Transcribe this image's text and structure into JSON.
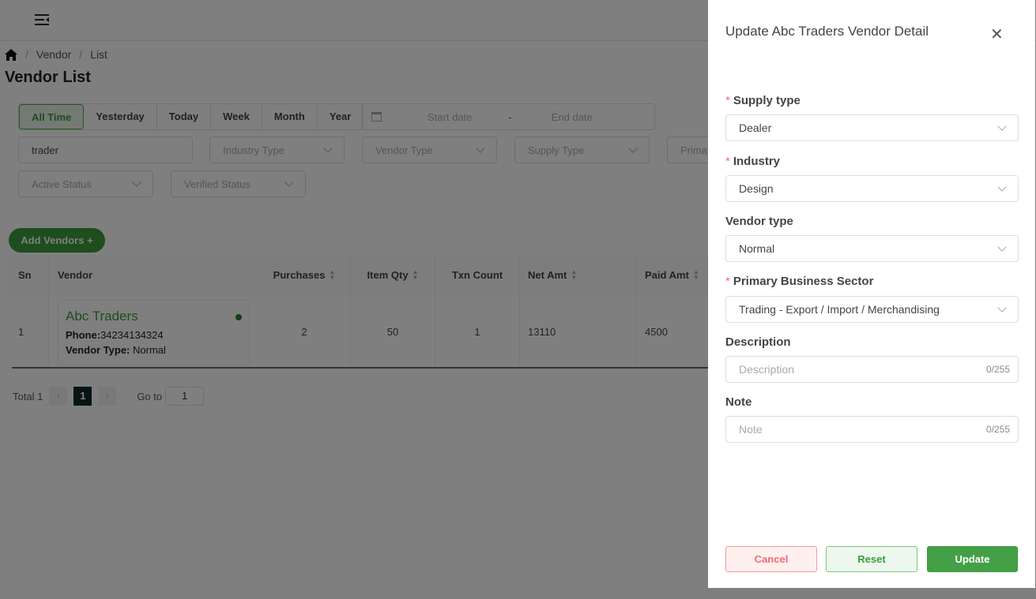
{
  "header": {
    "menu_icon": "menu-fold-icon"
  },
  "breadcrumb": {
    "home_icon": "home-icon",
    "items": [
      "Vendor",
      "List"
    ]
  },
  "page_title": "Vendor List",
  "filters": {
    "periods": [
      "All Time",
      "Yesterday",
      "Today",
      "Week",
      "Month",
      "Year"
    ],
    "active_period": "All Time",
    "start_placeholder": "Start date",
    "end_placeholder": "End date",
    "date_sep": "-",
    "search_value": "trader",
    "selects": [
      "Industry Type",
      "Vendor Type",
      "Supply Type",
      "Prima",
      "Active Status",
      "Verified Status"
    ]
  },
  "add_button": "Add Vendors +",
  "table": {
    "columns": [
      "Sn",
      "Vendor",
      "Purchases",
      "Item Qty",
      "Txn Count",
      "Net Amt",
      "Paid Amt"
    ],
    "rows": [
      {
        "sn": "1",
        "name": "Abc Traders",
        "phone_label": "Phone:",
        "phone": "34234134324",
        "type_label": "Vendor Type:",
        "type": "Normal",
        "purchases": "2",
        "item_qty": "50",
        "txn_count": "1",
        "net_amt": "13110",
        "paid_amt": "4500"
      }
    ]
  },
  "pagination": {
    "total": "Total 1",
    "page": "1",
    "goto_label": "Go to",
    "goto_value": "1"
  },
  "drawer": {
    "title": "Update Abc Traders Vendor Detail",
    "fields": [
      {
        "label": "Supply type",
        "required": true,
        "value": "Dealer"
      },
      {
        "label": "Industry",
        "required": true,
        "value": "Design"
      },
      {
        "label": "Vendor type",
        "required": false,
        "value": "Normal"
      },
      {
        "label": "Primary Business Sector",
        "required": true,
        "value": "Trading - Export / Import / Merchandising"
      },
      {
        "label": "Description",
        "placeholder": "Description",
        "count": "0/255"
      },
      {
        "label": "Note",
        "placeholder": "Note",
        "count": "0/255"
      }
    ],
    "required_mark": "*",
    "cancel": "Cancel",
    "reset": "Reset",
    "update": "Update"
  },
  "colors": {
    "primary": "#3d9a3d",
    "danger": "#f56c6c"
  }
}
